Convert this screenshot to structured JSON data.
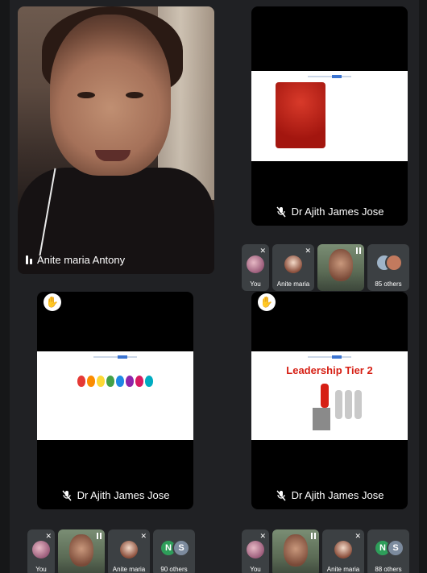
{
  "app": {
    "accent_color": "#202124"
  },
  "main_tiles": {
    "speaker": {
      "name": "Anite maria Antony",
      "audio_indicator": "audio-bars-icon"
    },
    "share_top": {
      "presenter": "Dr Ajith James Jose",
      "mic": "mic-off-icon"
    },
    "share_bottom_left": {
      "presenter": "Dr Ajith James Jose",
      "mic": "mic-off-icon"
    },
    "share_bottom_right": {
      "presenter": "Dr Ajith James Jose",
      "mic": "mic-off-icon",
      "slide_title": "Leadership Tier 2"
    }
  },
  "strips": {
    "top": {
      "you": "You",
      "participant": "Anite maria",
      "others": "85 others"
    },
    "bottom_left": {
      "you": "You",
      "participant": "Anite maria",
      "others": "90 others",
      "avatar_a": "N",
      "avatar_b": "S"
    },
    "bottom_right": {
      "you": "You",
      "participant": "Anite maria",
      "others": "88 others",
      "avatar_a": "N",
      "avatar_b": "S"
    }
  },
  "colors": {
    "avatar_n": "#2e9e5a",
    "avatar_s": "#7c8b9e",
    "slide_red": "#d61f14"
  }
}
